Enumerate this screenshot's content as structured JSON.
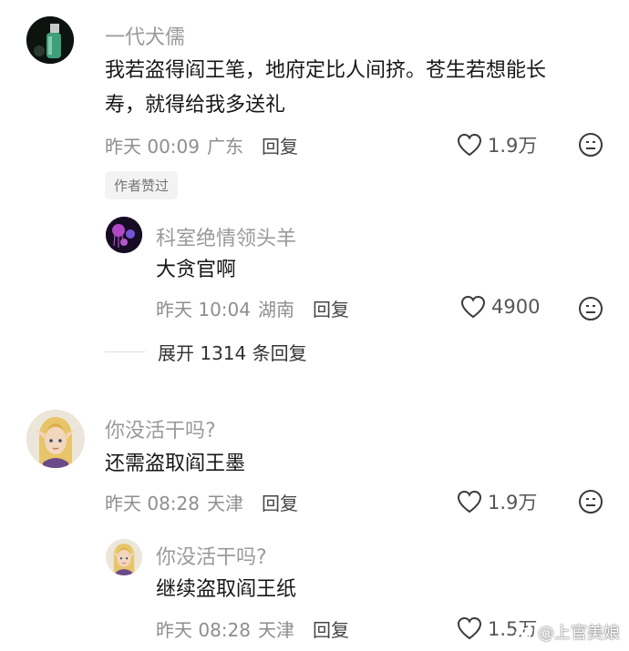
{
  "comments": [
    {
      "username": "一代犬儒",
      "content_lines": [
        "我若盗得阎王笔，地府定比人间挤。苍生若想能长",
        "寿，就得给我多送礼"
      ],
      "time": "昨天 00:09",
      "location": "广东",
      "reply_label": "回复",
      "likes": "1.9万",
      "badge": "作者赞过",
      "avatar_icon": "bottle-avatar-icon",
      "replies": [
        {
          "username": "科室绝情领头羊",
          "content": "大贪官啊",
          "time": "昨天 10:04",
          "location": "湖南",
          "reply_label": "回复",
          "likes": "4900",
          "avatar_icon": "jellyfish-avatar-icon"
        }
      ],
      "expand_label": "展开 1314 条回复"
    },
    {
      "username": "你没活干吗?",
      "content": "还需盗取阎王墨",
      "time": "昨天 08:28",
      "location": "天津",
      "reply_label": "回复",
      "likes": "1.9万",
      "avatar_icon": "elf-avatar-icon",
      "replies": [
        {
          "username": "你没活干吗?",
          "content": "继续盗取阎王纸",
          "time": "昨天 08:28",
          "location": "天津",
          "reply_label": "回复",
          "likes": "1.5万",
          "avatar_icon": "elf-avatar-icon"
        }
      ]
    }
  ],
  "watermark": "@上官美娘",
  "colors": {
    "username": "#9a9a9a",
    "content": "#161616",
    "meta": "#8e8e8e",
    "badge_bg": "#f3f3f3"
  }
}
